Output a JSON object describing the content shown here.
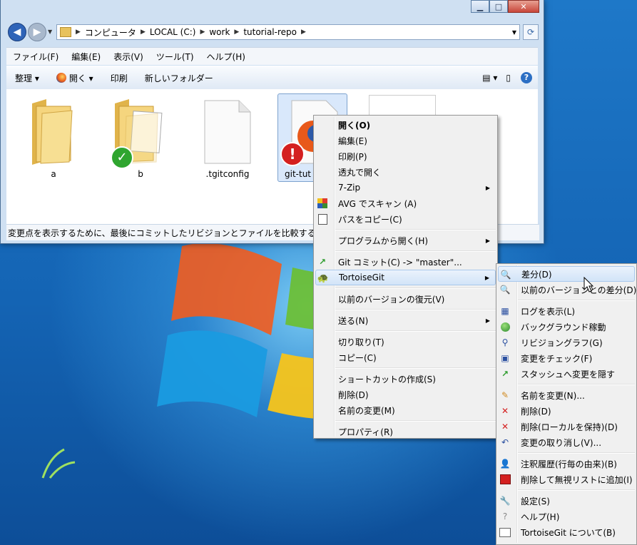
{
  "window": {
    "caption_buttons": [
      "minimize",
      "maximize",
      "close"
    ],
    "breadcrumb": [
      "コンピュータ",
      "LOCAL (C:)",
      "work",
      "tutorial-repo"
    ],
    "menubar": [
      "ファイル(F)",
      "編集(E)",
      "表示(V)",
      "ツール(T)",
      "ヘルプ(H)"
    ],
    "toolbar": {
      "organize": "整理 ▾",
      "open": "開く ▾",
      "print": "印刷",
      "new_folder": "新しいフォルダー"
    },
    "files": [
      {
        "name": "a",
        "type": "folder",
        "overlay": "none"
      },
      {
        "name": "b",
        "type": "folder",
        "overlay": "ok"
      },
      {
        "name": ".tgitconfig",
        "type": "file",
        "overlay": "none"
      },
      {
        "name": "git-tut",
        "type": "html-file",
        "overlay": "modified",
        "selected": true
      },
      {
        "name": "",
        "type": "file-partial",
        "overlay": "none"
      }
    ],
    "status": "変更点を表示するために、最後にコミットしたリビジョンとファイルを比較する"
  },
  "context_menu": {
    "items": [
      {
        "label": "開く(O)",
        "bold": true,
        "icon": ""
      },
      {
        "label": "編集(E)",
        "icon": ""
      },
      {
        "label": "印刷(P)",
        "icon": ""
      },
      {
        "label": "透丸で開く",
        "icon": ""
      },
      {
        "label": "7-Zip",
        "submenu": true,
        "icon": ""
      },
      {
        "label": "AVG でスキャン (A)",
        "icon": "avg-icon"
      },
      {
        "label": "パスをコピー(C)",
        "icon": "copy-path-icon"
      },
      {
        "separator": true
      },
      {
        "label": "プログラムから開く(H)",
        "submenu": true
      },
      {
        "separator": true
      },
      {
        "label": "Git コミット(C) -> \"master\"...",
        "icon": "git-commit-icon"
      },
      {
        "label": "TortoiseGit",
        "submenu": true,
        "highlight": true,
        "icon": "tortoisegit-icon"
      },
      {
        "separator": true
      },
      {
        "label": "以前のバージョンの復元(V)"
      },
      {
        "separator": true
      },
      {
        "label": "送る(N)",
        "submenu": true
      },
      {
        "separator": true
      },
      {
        "label": "切り取り(T)"
      },
      {
        "label": "コピー(C)"
      },
      {
        "separator": true
      },
      {
        "label": "ショートカットの作成(S)"
      },
      {
        "label": "削除(D)"
      },
      {
        "label": "名前の変更(M)"
      },
      {
        "separator": true
      },
      {
        "label": "プロパティ(R)"
      }
    ]
  },
  "tortoise_menu": {
    "items": [
      {
        "label": "差分(D)",
        "icon": "diff-icon",
        "highlight": true
      },
      {
        "label": "以前のバージョンとの差分(D)",
        "icon": "diff-previous-icon"
      },
      {
        "separator": true
      },
      {
        "label": "ログを表示(L)",
        "icon": "log-icon"
      },
      {
        "label": "バックグラウンド稼動",
        "icon": "globe-icon"
      },
      {
        "label": "リビジョングラフ(G)",
        "icon": "revision-graph-icon"
      },
      {
        "label": "変更をチェック(F)",
        "icon": "check-changes-icon"
      },
      {
        "label": "スタッシュへ変更を隠す",
        "icon": "stash-icon"
      },
      {
        "separator": true
      },
      {
        "label": "名前を変更(N)...",
        "icon": "pencil-icon"
      },
      {
        "label": "削除(D)",
        "icon": "delete-icon"
      },
      {
        "label": "削除(ローカルを保持)(D)",
        "icon": "delete-keep-icon"
      },
      {
        "label": "変更の取り消し(V)...",
        "icon": "revert-icon"
      },
      {
        "separator": true
      },
      {
        "label": "注釈履歴(行毎の由来)(B)",
        "icon": "blame-icon"
      },
      {
        "label": "削除して無視リストに追加(I)",
        "icon": "ignore-icon"
      },
      {
        "separator": true
      },
      {
        "label": "設定(S)",
        "icon": "settings-icon"
      },
      {
        "label": "ヘルプ(H)",
        "icon": "help-icon"
      },
      {
        "label": "TortoiseGit について(B)",
        "icon": "about-icon"
      }
    ]
  }
}
